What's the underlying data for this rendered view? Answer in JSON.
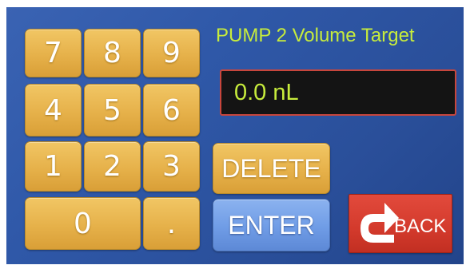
{
  "header": {
    "title": "PUMP 2 Volume Target"
  },
  "display": {
    "value": "0.0 nL"
  },
  "keypad": {
    "keys": [
      "7",
      "8",
      "9",
      "4",
      "5",
      "6",
      "1",
      "2",
      "3",
      "0",
      "."
    ]
  },
  "actions": {
    "delete_label": "DELETE",
    "enter_label": "ENTER",
    "back_label": "BACK"
  },
  "colors": {
    "screen_background": "#2f58a8",
    "key_gold": "#e6b14a",
    "enter_blue": "#6f9ce6",
    "back_red": "#d33a2c",
    "display_text": "#c7ec3c",
    "display_border": "#c8463c"
  },
  "icons": {
    "back": "back-arrow-icon"
  }
}
